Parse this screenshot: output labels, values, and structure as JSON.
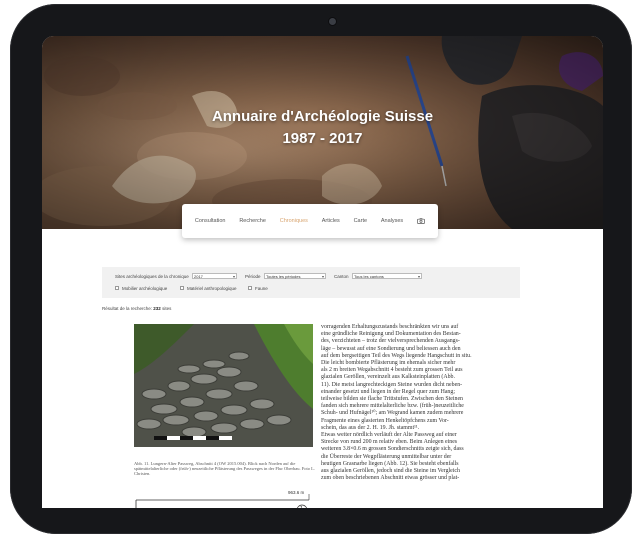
{
  "hero": {
    "title": "Annuaire d'Archéologie Suisse",
    "subtitle": "1987 - 2017"
  },
  "nav": {
    "items": [
      {
        "label": "Consultation"
      },
      {
        "label": "Recherche"
      },
      {
        "label": "Chroniques"
      },
      {
        "label": "Articles"
      },
      {
        "label": "Carte"
      },
      {
        "label": "Analyses"
      }
    ],
    "active_index": 2,
    "accent_color": "#d8a46f",
    "icon": "camera-icon"
  },
  "filters": {
    "year_label": "Sites archéologiques de la chronique",
    "year_value": "2017",
    "period_label": "Période",
    "period_value": "Toutes les périodes",
    "canton_label": "Canton",
    "canton_value": "Tous les cantons",
    "checkboxes": [
      {
        "label": "Mobilier archéologique",
        "checked": false
      },
      {
        "label": "Matériel anthropologique",
        "checked": false
      },
      {
        "label": "Faune",
        "checked": false
      }
    ]
  },
  "results": {
    "label": "Résultat de la recherche:",
    "count": "232",
    "unit": "sites"
  },
  "article": {
    "figure_caption": "Abb. 11. Lungern-Alter Passweg, Abschnitt 4 (OW 2015.004). Blick nach Norden auf die spätmittelalterliche oder (früh-) neuzeitliche Pflästerung des Passweges in der Flur Oberbau. Foto L. Christen.",
    "plan_elevation": "963.6 m",
    "plan_number": "1",
    "body_lines": [
      "vorragenden Erhaltungszustands beschränkten wir uns auf",
      "eine gründliche Reinigung und Dokumentation des Bestan-",
      "des, verzichteten – trotz der vielversprechenden Ausgangs-",
      "läge – bewusst auf eine Sondierung und beliessen auch den",
      "auf dem bergseitigen Teil des Wegs liegende Hangschutt in situ.",
      "Die leicht bombierte Pflästerung im ehemals sicher mehr",
      "als 2 m breiten Wegabschnitt 4 besteht zum grossen Teil aus",
      "glazialen Geröllen, vereinzelt aus Kalksteinplatten (Abb.",
      "11). Die meist langrechteckigen Steine wurden dicht neben-",
      "einander gesetzt und liegen in der Regel quer zum Hang;",
      "teilweise bilden sie flache Trittstufen. Zwischen den Steinen",
      "fanden sich mehrere mittelalterliche bzw. (früh-)neuzeitliche",
      "Schuh- und Hufnägel¹⁰; am Wegrand kamen zudem mehrere",
      "Fragmente eines glasierten Henkeltöpfchens zum Vor-",
      "schein, das aus der 2. H. 19. Jh. stammt¹¹.",
      "Etwas weiter nördlich verläuft der Alte Passweg auf einer",
      "Strecke von rund 200 m relativ eben. Beim Anlegen eines",
      "weiteren 3.8×0.6 m grossen Sondierschnitts zeigte sich, dass",
      "die Überreste der Wegpflästerung unmittelbar unter der",
      "heutigen Grasnarbe liegen (Abb. 12). Sie besteht ebenfalls",
      "aus glazialen Geröllen, jedoch sind die Steine im Vergleich",
      "zum oben beschriebenen Abschnitt etwas grösser und plat-"
    ]
  }
}
